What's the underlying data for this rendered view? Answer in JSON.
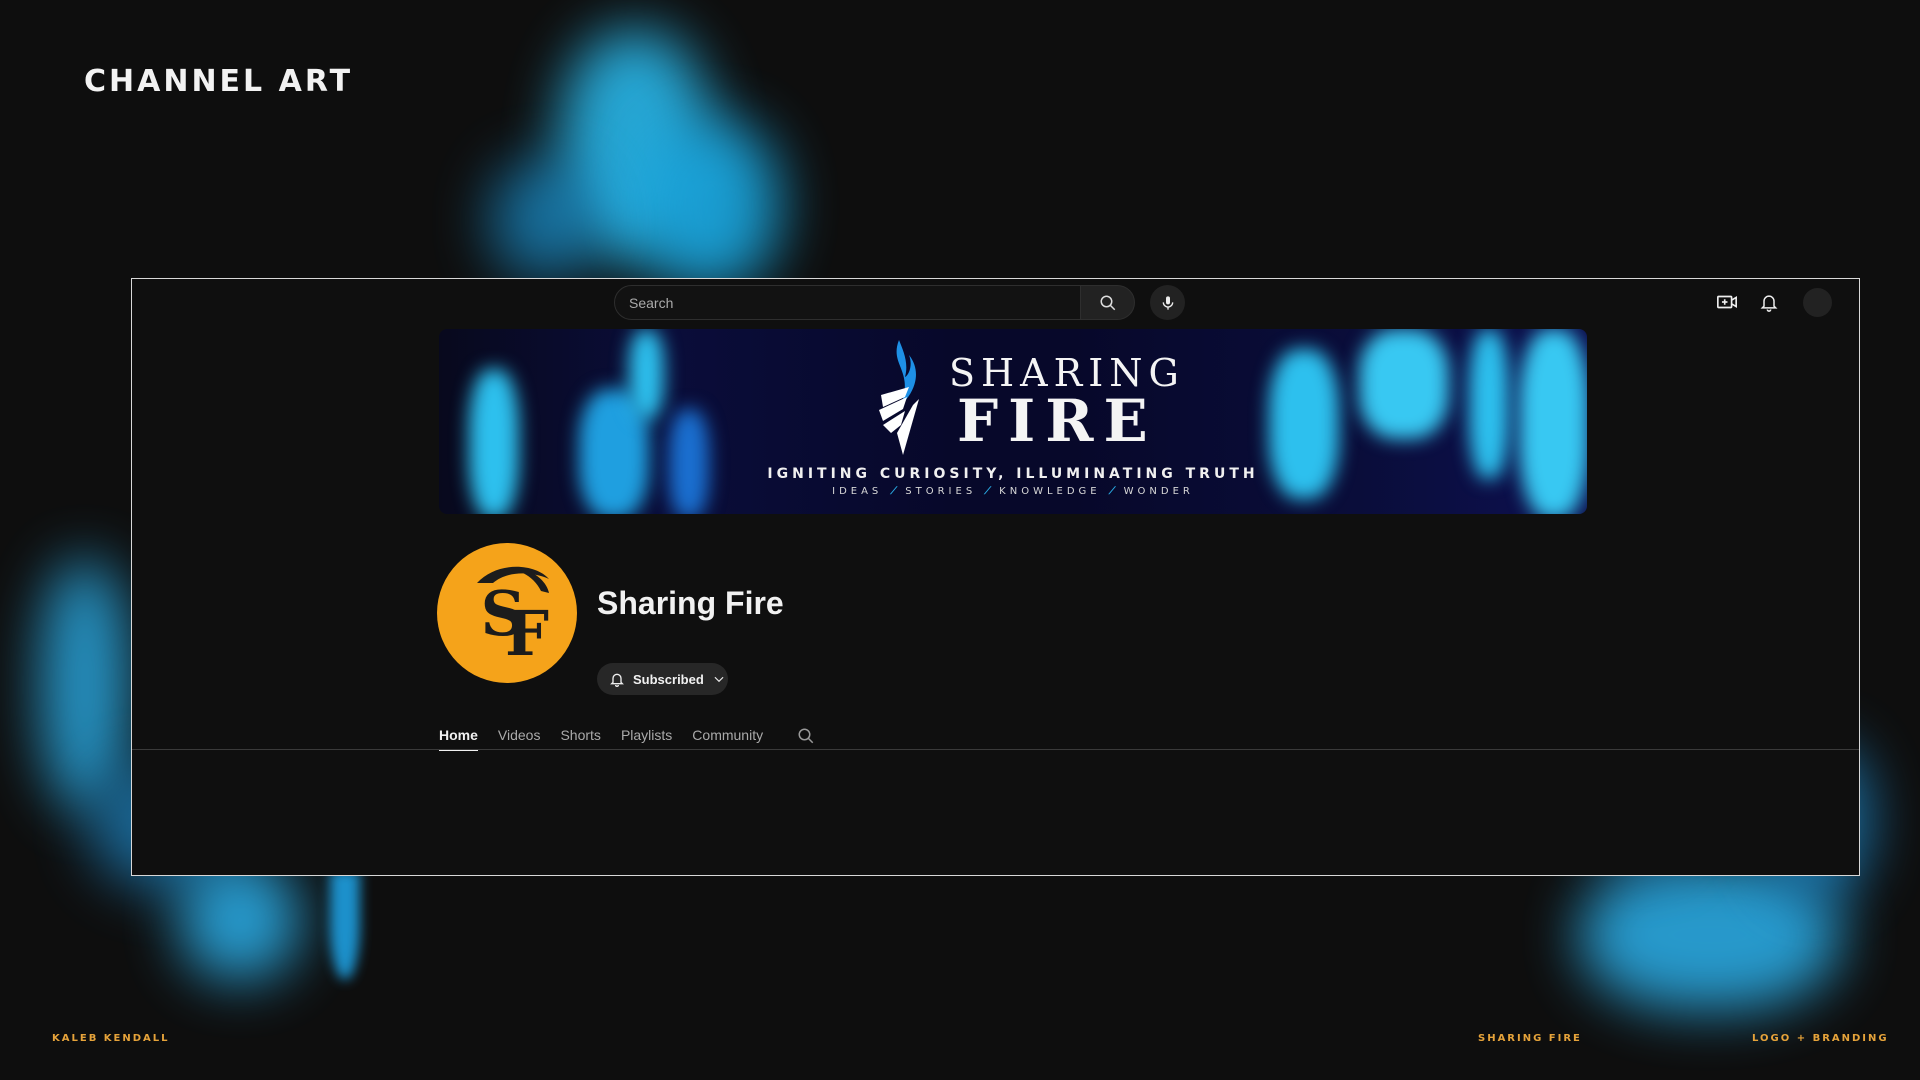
{
  "section_title": "CHANNEL ART",
  "topbar": {
    "search_placeholder": "Search",
    "search_icon": "search-icon",
    "mic_icon": "microphone-icon",
    "create_icon": "create-video-icon",
    "notifications_icon": "bell-icon"
  },
  "banner": {
    "title_line1": "SHARING",
    "title_line2": "FIRE",
    "tagline": "IGNITING CURIOSITY, ILLUMINATING TRUTH",
    "sub_items": [
      "IDEAS",
      "STORIES",
      "KNOWLEDGE",
      "WONDER"
    ],
    "sub_separator": "⟋"
  },
  "channel": {
    "name": "Sharing Fire",
    "avatar_letters": "SF",
    "avatar_color": "#f5a31a",
    "subscribe_label": "Subscribed"
  },
  "tabs": [
    {
      "label": "Home",
      "active": true
    },
    {
      "label": "Videos",
      "active": false
    },
    {
      "label": "Shorts",
      "active": false
    },
    {
      "label": "Playlists",
      "active": false
    },
    {
      "label": "Community",
      "active": false
    }
  ],
  "footer": {
    "left": "KALEB KENDALL",
    "middle": "SHARING FIRE",
    "right": "LOGO + BRANDING"
  },
  "colors": {
    "accent_blue": "#29b6e8",
    "accent_orange": "#e6a33a",
    "background": "#0e0e0e"
  }
}
